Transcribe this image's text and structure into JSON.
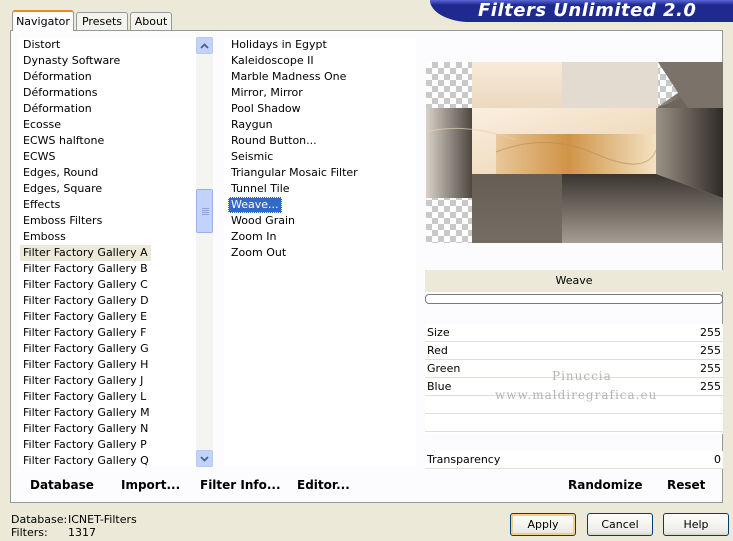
{
  "title": "Filters Unlimited 2.0",
  "tabs": [
    "Navigator",
    "Presets",
    "About"
  ],
  "categories": [
    "Distort",
    "Dynasty Software",
    "Déformation",
    "Déformations",
    "Déformation",
    "Ecosse",
    "ECWS halftone",
    "ECWS",
    "Edges, Round",
    "Edges, Square",
    "Effects",
    "Emboss Filters",
    "Emboss",
    "Filter Factory Gallery A",
    "Filter Factory Gallery B",
    "Filter Factory Gallery C",
    "Filter Factory Gallery D",
    "Filter Factory Gallery E",
    "Filter Factory Gallery F",
    "Filter Factory Gallery G",
    "Filter Factory Gallery H",
    "Filter Factory Gallery J",
    "Filter Factory Gallery L",
    "Filter Factory Gallery M",
    "Filter Factory Gallery N",
    "Filter Factory Gallery P",
    "Filter Factory Gallery Q"
  ],
  "selected_category": "Filter Factory Gallery A",
  "filters": [
    "Holidays in Egypt",
    "Kaleidoscope II",
    "Marble Madness One",
    "Mirror, Mirror",
    "Pool Shadow",
    "Raygun",
    "Round Button...",
    "Seismic",
    "Triangular Mosaic Filter",
    "Tunnel Tile",
    "Weave...",
    "Wood Grain",
    "Zoom In",
    "Zoom Out"
  ],
  "selected_filter": "Weave...",
  "filter_name": "Weave",
  "params": [
    {
      "label": "Size",
      "value": "255"
    },
    {
      "label": "Red",
      "value": "255"
    },
    {
      "label": "Green",
      "value": "255"
    },
    {
      "label": "Blue",
      "value": "255"
    }
  ],
  "transparency": {
    "label": "Transparency",
    "value": "0"
  },
  "buttons": {
    "database": "Database",
    "import": "Import...",
    "filter_info": "Filter Info...",
    "editor": "Editor...",
    "randomize": "Randomize",
    "reset": "Reset",
    "apply": "Apply",
    "cancel": "Cancel",
    "help": "Help"
  },
  "status": {
    "database_label": "Database:",
    "database_value": "ICNET-Filters",
    "filters_label": "Filters:",
    "filters_value": "1317"
  },
  "watermark": [
    "Pinuccia",
    "www.maldiregrafica.eu"
  ],
  "icons": {
    "scroll_up": "chevron-up-icon",
    "scroll_down": "chevron-down-icon"
  }
}
